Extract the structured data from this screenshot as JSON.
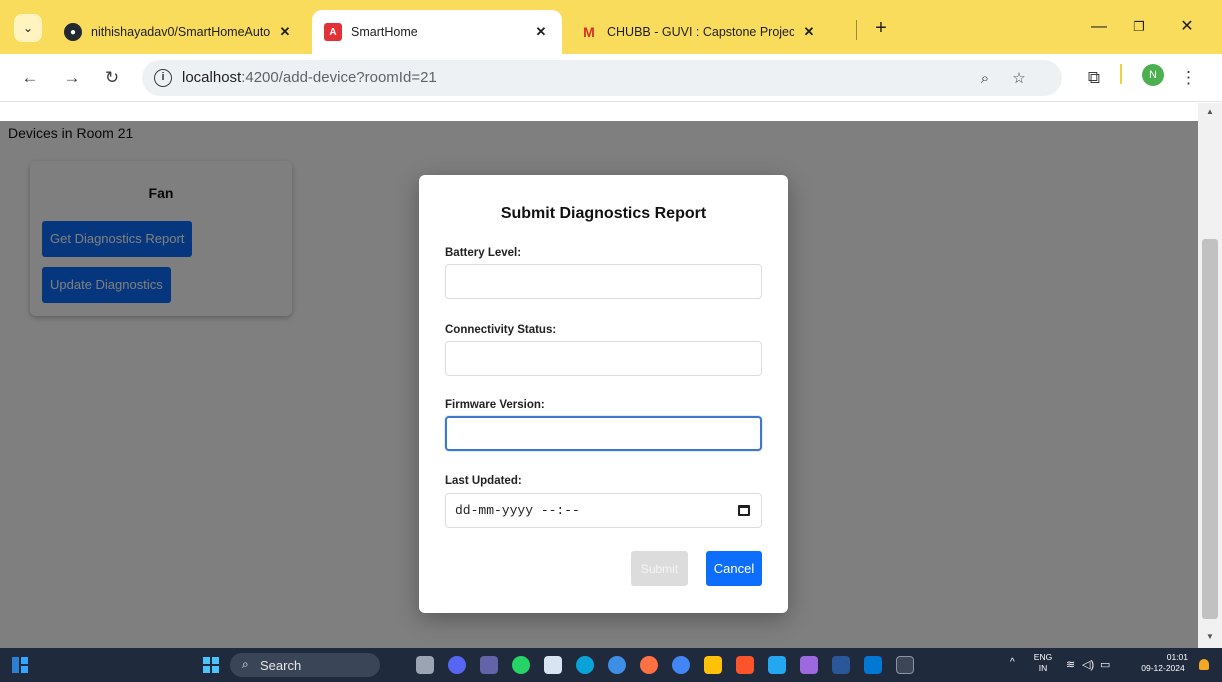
{
  "browser": {
    "tabs": [
      {
        "title": "nithishayadav0/SmartHomeAutom",
        "favicon": "github-icon",
        "active": false
      },
      {
        "title": "SmartHome",
        "favicon": "angular-icon",
        "active": true
      },
      {
        "title": "CHUBB - GUVI : Capstone Project",
        "favicon": "gmail-icon",
        "active": false
      }
    ],
    "new_tab": "+",
    "url_host": "localhost",
    "url_path": ":4200/add-device?roomId=21",
    "profile_initial": "N",
    "accent": "#f9dc5c"
  },
  "page": {
    "heading": "Devices in Room 21",
    "device": {
      "name": "Fan",
      "get_report_label": "Get Diagnostics Report",
      "update_label": "Update Diagnostics"
    }
  },
  "modal": {
    "title": "Submit Diagnostics Report",
    "fields": [
      {
        "label": "Battery Level:",
        "value": ""
      },
      {
        "label": "Connectivity Status:",
        "value": ""
      },
      {
        "label": "Firmware Version:",
        "value": ""
      },
      {
        "label": "Last Updated:",
        "value": "dd-mm-yyyy --:--"
      }
    ],
    "submit_label": "Submit",
    "cancel_label": "Cancel",
    "primary_color": "#0d6efd"
  },
  "taskbar": {
    "search_label": "Search",
    "lang_top": "ENG",
    "lang_bottom": "IN",
    "time": "01:01",
    "date": "09-12-2024"
  }
}
